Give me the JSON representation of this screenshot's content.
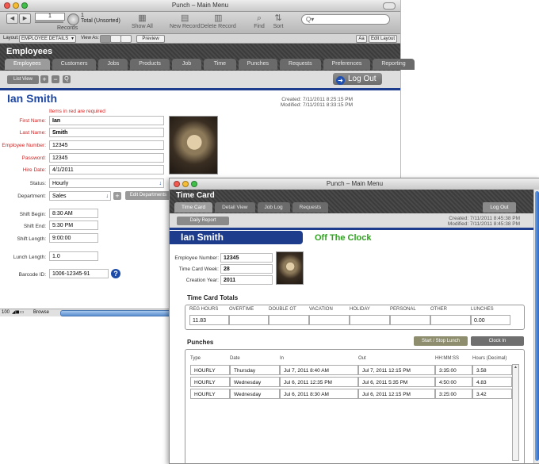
{
  "back_window": {
    "title": "Punch – Main Menu",
    "toolbar": {
      "record_value": "1",
      "record_total": "1",
      "record_status": "Total (Unsorted)",
      "records_label": "Records",
      "show_all": "Show All",
      "new_record": "New Record",
      "delete_record": "Delete Record",
      "find": "Find",
      "sort": "Sort",
      "search_placeholder": "Q▾"
    },
    "layoutbar": {
      "layout_label": "Layout:",
      "layout_value": "EMPLOYEE DETAILS",
      "view_as_label": "View As:",
      "preview": "Preview",
      "aa": "Aa",
      "edit_layout": "Edit Layout"
    },
    "header_title": "Employees",
    "tabs": [
      "Employees",
      "Customers",
      "Jobs",
      "Products",
      "Job Logs",
      "Time Cards",
      "Punches",
      "Requests",
      "Preferences",
      "Reporting"
    ],
    "list_view": "List View",
    "add_symbol": "+",
    "remove_symbol": "−",
    "find_symbol": "Q",
    "logout": "Log Out",
    "employee_name": "Ian Smith",
    "created": "Created: 7/11/2011 8:25:15 PM",
    "modified": "Modified: 7/11/2011 8:33:15 PM",
    "required_note": "Items in red are required",
    "fields": {
      "first_name_label": "First Name:",
      "first_name": "Ian",
      "last_name_label": "Last Name:",
      "last_name": "Smith",
      "employee_number_label": "Employee Number:",
      "employee_number": "12345",
      "password_label": "Password:",
      "password": "12345",
      "hire_date_label": "Hire Date:",
      "hire_date": "4/1/2011",
      "status_label": "Status:",
      "status": "Hourly",
      "department_label": "Department:",
      "department": "Sales",
      "edit_departments": "Edit Departments",
      "shift_begin_label": "Shift Begin:",
      "shift_begin": "8:30 AM",
      "shift_end_label": "Shift End:",
      "shift_end": "5:30 PM",
      "shift_length_label": "Shift Length:",
      "shift_length": "9:00:00",
      "lunch_length_label": "Lunch Length:",
      "lunch_length": "1.0",
      "barcode_label": "Barcode ID:",
      "barcode": "1006-12345-91",
      "help": "?"
    },
    "status_bar": {
      "zoom": "100",
      "mode": "Browse"
    }
  },
  "front_window": {
    "title": "Punch – Main Menu",
    "header_title": "Time Card",
    "tabs": [
      "Time Card",
      "Detail View",
      "Job Log",
      "Requests"
    ],
    "logout": "Log Out",
    "daily_report": "Daily Report",
    "created": "Created: 7/11/2011 8:45:38 PM",
    "modified": "Modified: 7/11/2011 8:45:38 PM",
    "employee_name": "Ian Smith",
    "clock_status": "Off The Clock",
    "fields": {
      "employee_number_label": "Employee Number:",
      "employee_number": "12345",
      "week_label": "Time Card Week:",
      "week": "28",
      "year_label": "Creation Year:",
      "year": "2011"
    },
    "totals": {
      "title": "Time Card Totals",
      "headers": [
        "REG HOURS",
        "OVERTIME",
        "DOUBLE OT",
        "VACATION",
        "HOLIDAY",
        "PERSONAL",
        "OTHER",
        "LUNCHES"
      ],
      "values": [
        "11.83",
        "",
        "",
        "",
        "",
        "",
        "",
        "0.00"
      ]
    },
    "punches": {
      "title": "Punches",
      "start_stop_lunch": "Start / Stop Lunch",
      "clock_in": "Clock In",
      "headers": [
        "Type",
        "Date",
        "In",
        "Out",
        "HH:MM:SS",
        "Hours (Decimal)"
      ],
      "rows": [
        [
          "HOURLY",
          "Thursday",
          "Jul 7, 2011 8:40 AM",
          "Jul 7, 2011 12:15 PM",
          "3:35:00",
          "3.58"
        ],
        [
          "HOURLY",
          "Wednesday",
          "Jul 6, 2011 12:35 PM",
          "Jul 6, 2011 5:35 PM",
          "4:50:00",
          "4.83"
        ],
        [
          "HOURLY",
          "Wednesday",
          "Jul 6, 2011 8:30 AM",
          "Jul 6, 2011 12:15 PM",
          "3:25:00",
          "3.42"
        ]
      ]
    }
  },
  "colors": {
    "accent_blue": "#1d3d8c",
    "required_red": "#d21f1f",
    "clock_green": "#2fa31f"
  }
}
